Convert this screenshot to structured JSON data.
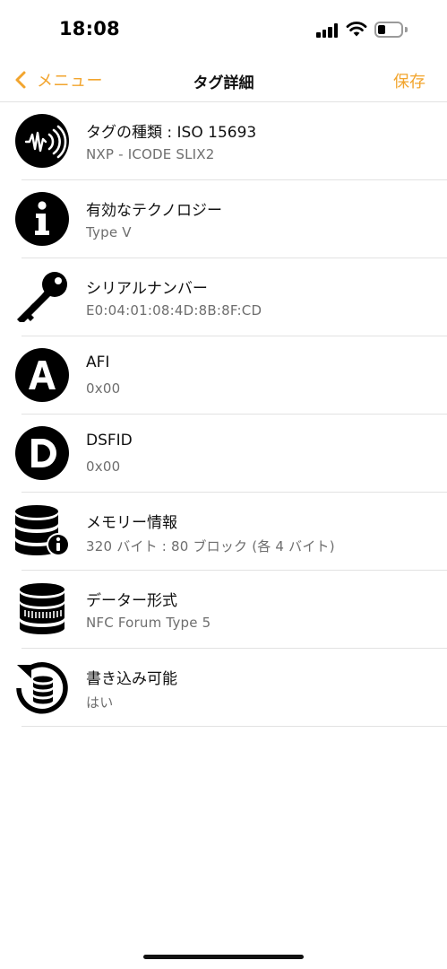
{
  "status_bar": {
    "time": "18:08",
    "battery_level": 0.35
  },
  "nav": {
    "back_label": "メニュー",
    "title": "タグ詳細",
    "save_label": "保存"
  },
  "colors": {
    "accent": "#f2a52e",
    "icon": "#000000",
    "subtitle": "#6e6e6e",
    "separator": "#e2e2e2"
  },
  "rows": [
    {
      "icon": "nfc-wave-icon",
      "title": "タグの種類 : ISO 15693",
      "subtitle": "NXP - ICODE SLIX2"
    },
    {
      "icon": "info-icon",
      "title": "有効なテクノロジー",
      "subtitle": "Type V"
    },
    {
      "icon": "key-icon",
      "title": "シリアルナンバー",
      "subtitle": "E0:04:01:08:4D:8B:8F:CD"
    },
    {
      "icon": "letter-a-icon",
      "title": "AFI",
      "subtitle": "0x00"
    },
    {
      "icon": "letter-d-icon",
      "title": "DSFID",
      "subtitle": "0x00"
    },
    {
      "icon": "database-info-icon",
      "title": "メモリー情報",
      "subtitle": "320 バイト : 80 ブロック (各 4 バイト)"
    },
    {
      "icon": "database-format-icon",
      "title": "データー形式",
      "subtitle": "NFC Forum Type 5"
    },
    {
      "icon": "database-rewrite-icon",
      "title": "書き込み可能",
      "subtitle": "はい"
    }
  ]
}
